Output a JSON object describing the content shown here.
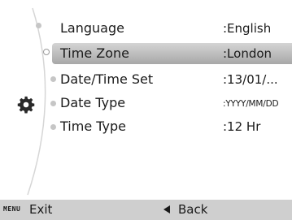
{
  "menu": {
    "items": [
      {
        "label": "Language",
        "value": ":English"
      },
      {
        "label": "Time Zone",
        "value": ":London"
      },
      {
        "label": "Date/Time Set",
        "value": ":13/01/..."
      },
      {
        "label": "Date Type",
        "value": ":YYYY/MM/DD"
      },
      {
        "label": "Time Type",
        "value": ":12 Hr"
      }
    ],
    "selected_index": 1
  },
  "icons": {
    "settings": "gear-icon",
    "back": "left-triangle-icon"
  },
  "bottom_bar": {
    "menu_key": "MENU",
    "exit_label": "Exit",
    "back_label": "Back"
  },
  "colors": {
    "selection": "#b8b8b8",
    "bar": "#cfcfcf"
  }
}
